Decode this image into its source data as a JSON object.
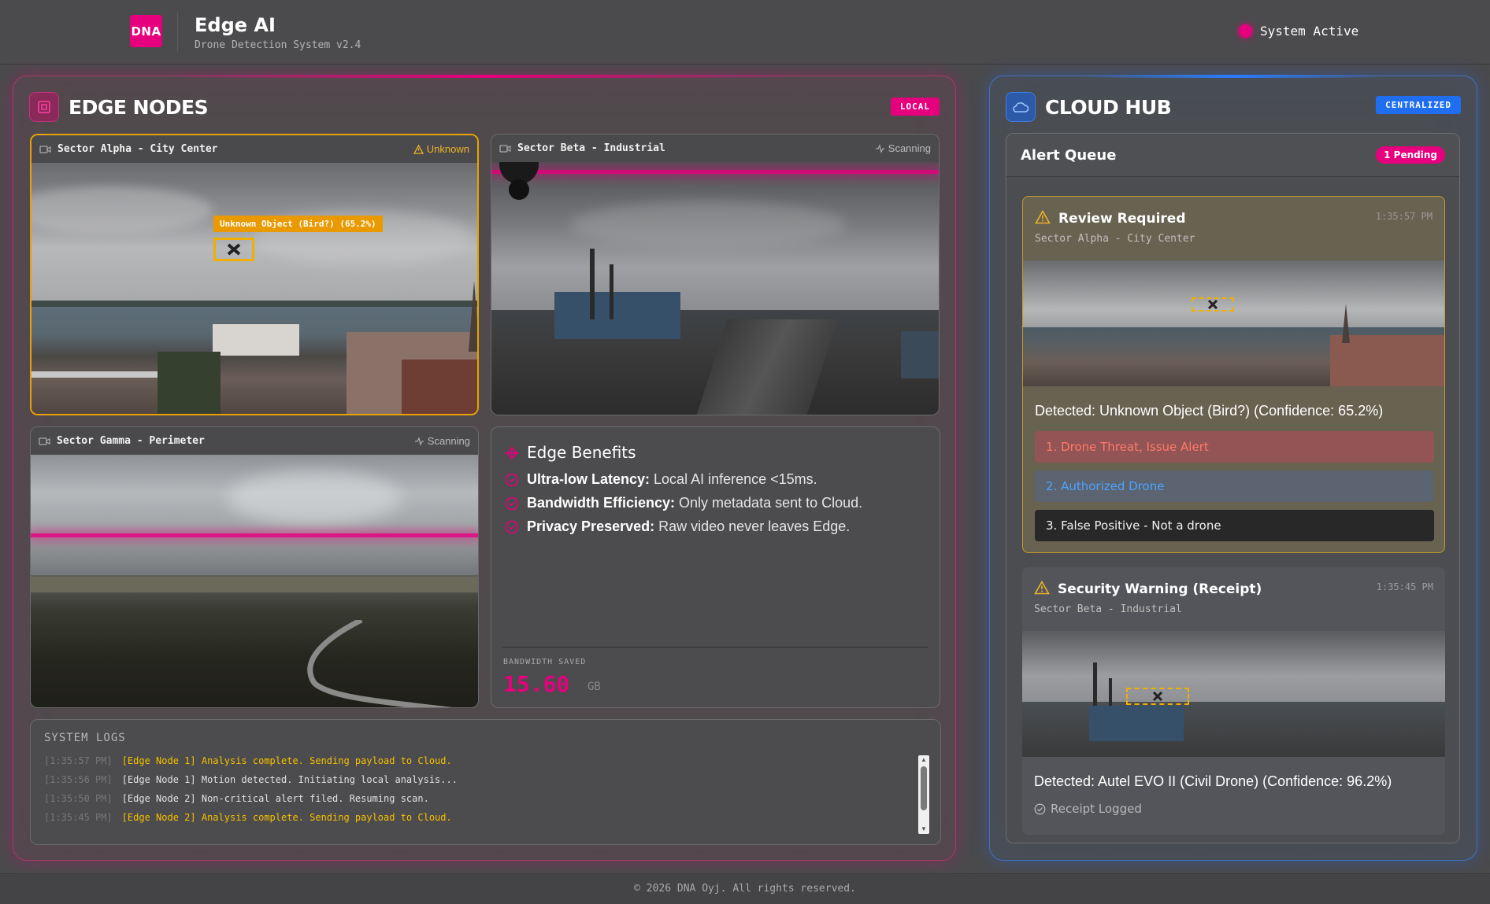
{
  "header": {
    "logo_text": "DNA",
    "title": "Edge AI",
    "subtitle": "Drone Detection System v2.4",
    "status": "System Active"
  },
  "edge": {
    "title": "EDGE NODES",
    "tag": "LOCAL",
    "cameras": [
      {
        "name": "Sector Alpha - City Center",
        "status": "Unknown",
        "detection_label": "Unknown Object (Bird?) (65.2%)"
      },
      {
        "name": "Sector Beta - Industrial",
        "status": "Scanning"
      },
      {
        "name": "Sector Gamma - Perimeter",
        "status": "Scanning"
      }
    ],
    "benefits": {
      "title": "Edge Benefits",
      "items": [
        {
          "bold": "Ultra-low Latency:",
          "text": " Local AI inference <15ms."
        },
        {
          "bold": "Bandwidth Efficiency:",
          "text": " Only metadata sent to Cloud."
        },
        {
          "bold": "Privacy Preserved:",
          "text": " Raw video never leaves Edge."
        }
      ],
      "bandwidth_label": "BANDWIDTH SAVED",
      "bandwidth_value": "15.60",
      "bandwidth_unit": "GB"
    },
    "logs": {
      "title": "SYSTEM LOGS",
      "lines": [
        {
          "time": "[1:35:57 PM]",
          "msg": "[Edge Node 1] Analysis complete. Sending payload to Cloud."
        },
        {
          "time": "[1:35:56 PM]",
          "msg": "[Edge Node 1] Motion detected. Initiating local analysis..."
        },
        {
          "time": "[1:35:50 PM]",
          "msg": "[Edge Node 2] Non-critical alert filed. Resuming scan."
        },
        {
          "time": "[1:35:45 PM]",
          "msg": "[Edge Node 2] Analysis complete. Sending payload to Cloud."
        }
      ]
    }
  },
  "cloud": {
    "title": "CLOUD HUB",
    "tag": "CENTRALIZED",
    "queue_title": "Alert Queue",
    "pending": "1 Pending",
    "alerts": [
      {
        "title": "Review Required",
        "time": "1:35:57 PM",
        "sector": "Sector Alpha - City Center",
        "detected": "Detected: Unknown Object (Bird?) (Confidence: 65.2%)",
        "actions": [
          "1. Drone Threat, Issue Alert",
          "2. Authorized Drone",
          "3. False Positive - Not a drone"
        ]
      },
      {
        "title": "Security Warning (Receipt)",
        "time": "1:35:45 PM",
        "sector": "Sector Beta - Industrial",
        "detected": "Detected: Autel EVO II (Civil Drone) (Confidence: 96.2%)",
        "receipt": "Receipt Logged"
      }
    ]
  },
  "footer": "© 2026 DNA Oyj. All rights reserved.",
  "colors": {
    "brand": "#e6007e",
    "cloud": "#2b7bff",
    "warning": "#e8a300"
  }
}
